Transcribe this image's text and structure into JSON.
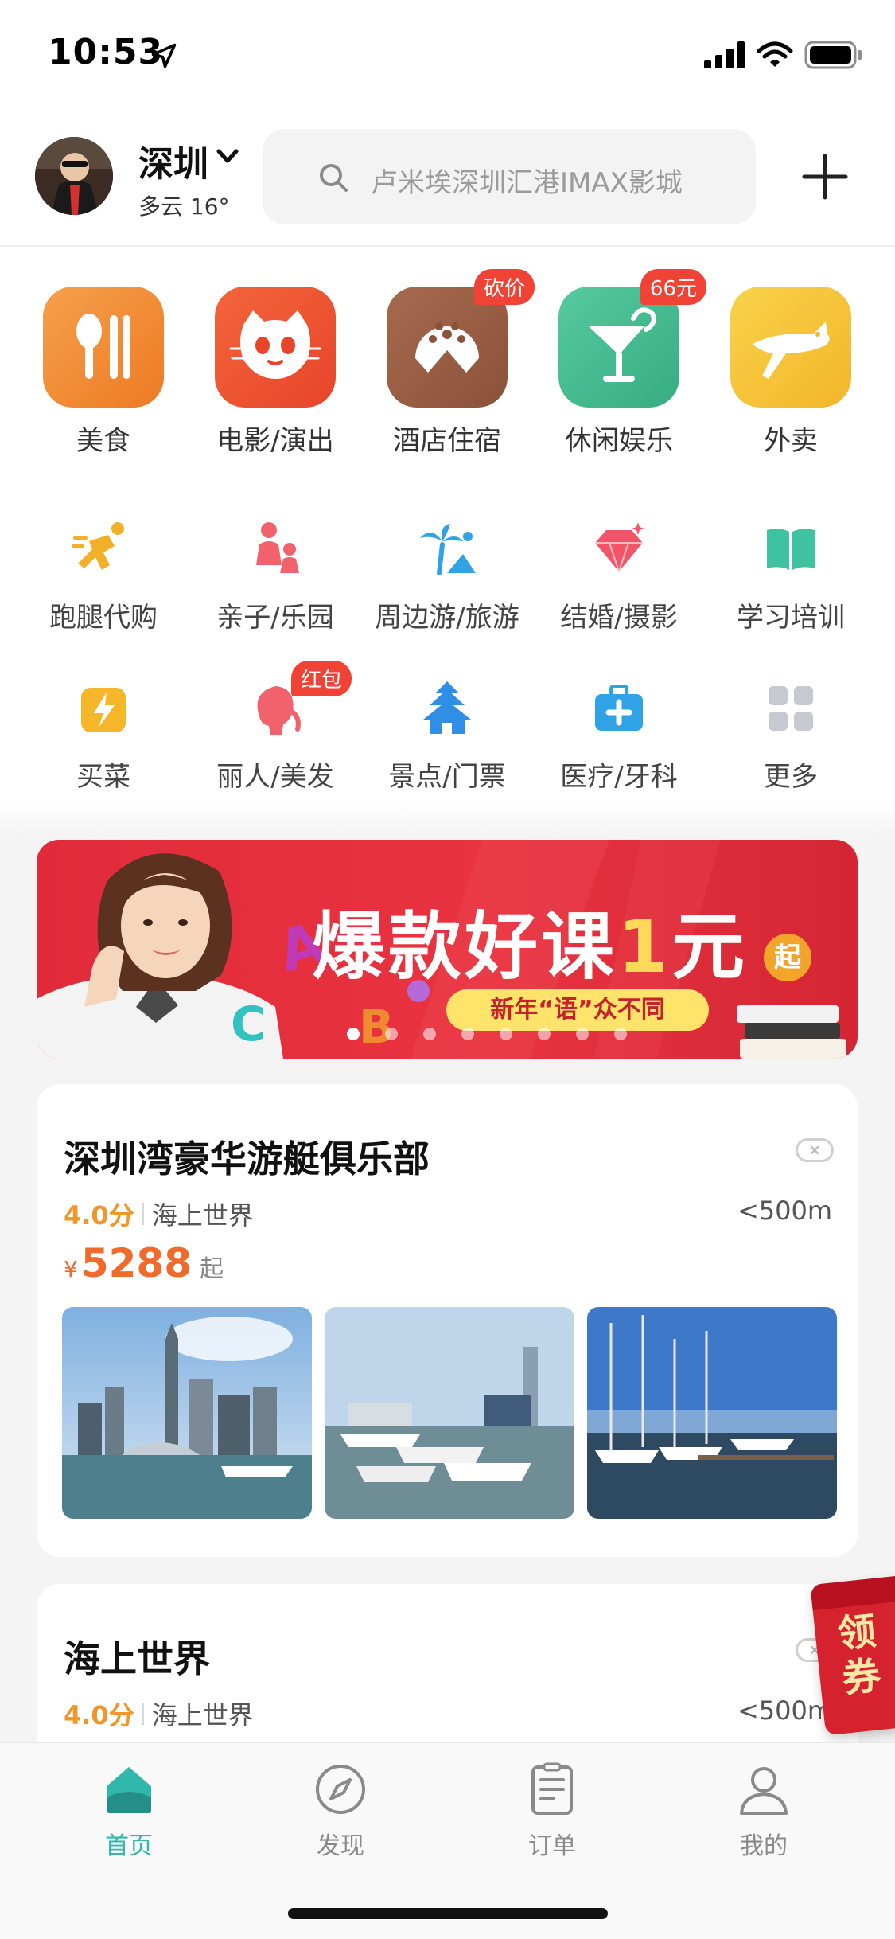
{
  "status": {
    "time": "10:53"
  },
  "header": {
    "city": "深圳",
    "weather": "多云 16°",
    "search_placeholder": "卢米埃深圳汇港IMAX影城"
  },
  "categories": [
    {
      "label": "美食",
      "color": "#f08a2a",
      "icon": "utensils-icon"
    },
    {
      "label": "电影/演出",
      "color": "#ef5a2c",
      "icon": "cat-icon"
    },
    {
      "label": "酒店住宿",
      "color": "#9a5d43",
      "icon": "hotel-icon",
      "badge": "砍价"
    },
    {
      "label": "休闲娱乐",
      "color": "#42b98c",
      "icon": "cocktail-icon",
      "badge": "66元"
    },
    {
      "label": "外卖",
      "color": "#f6c233",
      "icon": "kangaroo-icon"
    }
  ],
  "subcategories_row1": [
    {
      "label": "跑腿代购",
      "icon": "runner-icon"
    },
    {
      "label": "亲子/乐园",
      "icon": "parent-child-icon"
    },
    {
      "label": "周边游/旅游",
      "icon": "palm-tree-icon"
    },
    {
      "label": "结婚/摄影",
      "icon": "diamond-icon"
    },
    {
      "label": "学习培训",
      "icon": "book-icon"
    }
  ],
  "subcategories_row2": [
    {
      "label": "买菜",
      "icon": "lightning-bag-icon"
    },
    {
      "label": "丽人/美发",
      "icon": "woman-head-icon",
      "badge": "红包"
    },
    {
      "label": "景点/门票",
      "icon": "pagoda-icon"
    },
    {
      "label": "医疗/牙科",
      "icon": "medical-kit-icon"
    },
    {
      "label": "更多",
      "icon": "grid-icon"
    }
  ],
  "banner": {
    "title_prefix": "爆款好课",
    "title_number": "1",
    "title_suffix": "元",
    "title_qi": "起",
    "subtitle": "新年“语”众不同",
    "dot_count": 8,
    "active_dot": 0
  },
  "cards": [
    {
      "title": "深圳湾豪华游艇俱乐部",
      "score": "4.0分",
      "category": "海上世界",
      "distance": "<500m",
      "yen": "¥",
      "price": "5288",
      "price_suffix": "起"
    },
    {
      "title": "海上世界",
      "score": "4.0分",
      "category": "海上世界",
      "distance": "<500m"
    }
  ],
  "coupon": {
    "label": "领券"
  },
  "tabbar": [
    {
      "label": "首页",
      "icon": "home-icon",
      "active": true
    },
    {
      "label": "发现",
      "icon": "compass-icon"
    },
    {
      "label": "订单",
      "icon": "order-list-icon"
    },
    {
      "label": "我的",
      "icon": "profile-icon"
    }
  ],
  "colors": {
    "accent": "#31b7ac",
    "price": "#f06a2b",
    "score": "#f0962b",
    "badge": "#f04235"
  }
}
